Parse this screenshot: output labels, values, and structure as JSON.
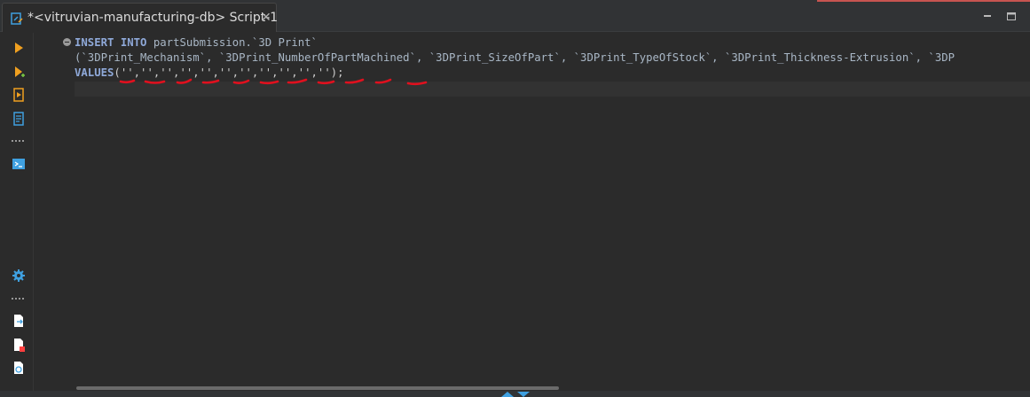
{
  "tab": {
    "title": "*<vitruvian-manufacturing-db> Script-1",
    "close_symbol": "✕",
    "icon": "sql-script-icon"
  },
  "window_controls": {
    "minimize_icon": "minimize-icon",
    "maximize_icon": "maximize-icon"
  },
  "toolbar": {
    "items": [
      {
        "icon": "execute-statement-icon",
        "color": "#f0a020"
      },
      {
        "icon": "execute-in-new-tab-icon",
        "color": "#f0a020"
      },
      {
        "icon": "execute-script-icon",
        "color": "#f0a020"
      },
      {
        "icon": "explain-plan-icon",
        "color": "#3fa0e0"
      },
      {
        "icon": "console-icon",
        "color": "#3fa0e0"
      },
      {
        "icon": "settings-gear-icon",
        "color": "#3fa0e0"
      },
      {
        "icon": "export-icon",
        "color": "#ffffff"
      },
      {
        "icon": "file-error-icon",
        "color": "#ff4040"
      },
      {
        "icon": "file-info-icon",
        "color": "#3fa0e0"
      }
    ]
  },
  "editor": {
    "line1": {
      "kw1": "INSERT",
      "kw2": "INTO",
      "table": "partSubmission.`3D Print`"
    },
    "line2": {
      "text": "(`3DPrint_Mechanism`, `3DPrint_NumberOfPartMachined`, `3DPrint_SizeOfPart`, `3DPrint_TypeOfStock`, `3DPrint_Thickness-Extrusion`, `3DP"
    },
    "line3": {
      "kw": "VALUES",
      "values": "('','','','','','','','','','','');"
    }
  },
  "colors": {
    "keyword": "#8fa9d9",
    "identifier": "#a9b7c6",
    "annotation_red": "#e0101e",
    "accent": "#c75450"
  }
}
